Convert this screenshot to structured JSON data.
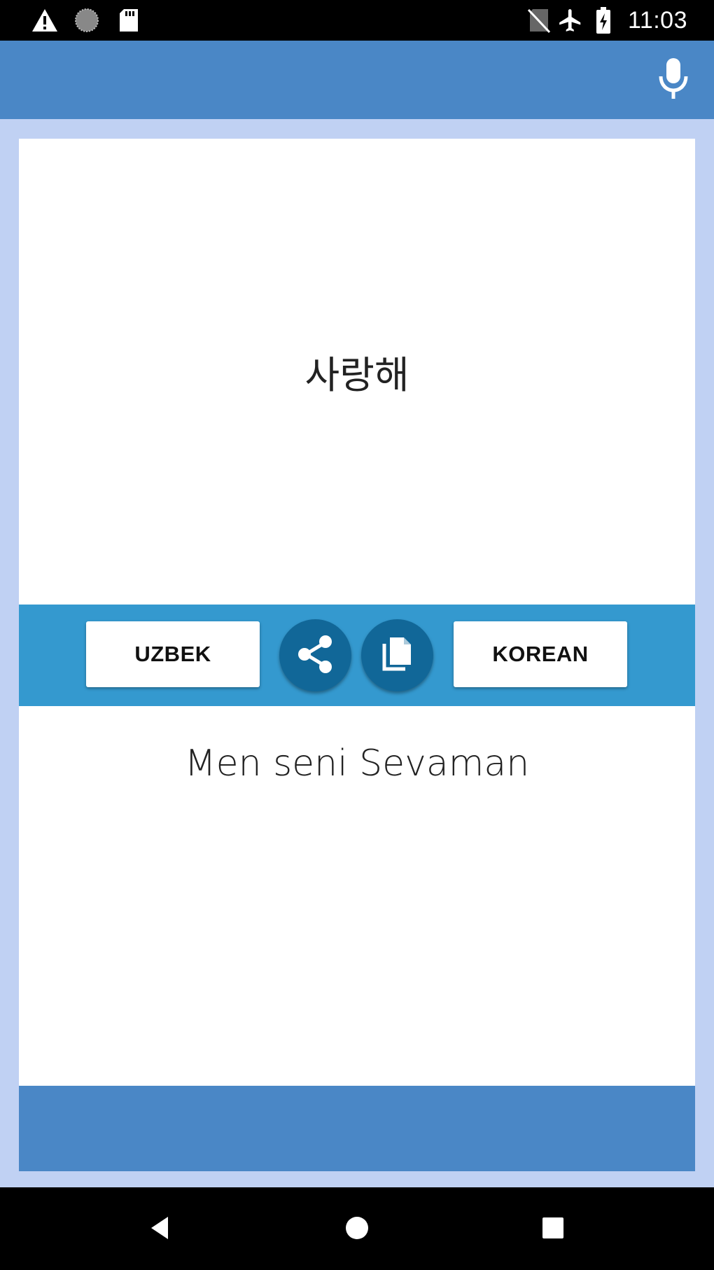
{
  "status_bar": {
    "time": "11:03",
    "icons": [
      "warning-icon",
      "sync-icon",
      "sd-card-icon",
      "no-sim-icon",
      "airplane-icon",
      "battery-charging-icon"
    ]
  },
  "app_bar": {
    "mic_icon": "microphone-icon"
  },
  "translation": {
    "source_text": "사랑해",
    "target_text": "Men seni Sevaman"
  },
  "toolbar": {
    "left_language": "UZBEK",
    "right_language": "KOREAN",
    "share_icon": "share-icon",
    "copy_icon": "copy-icon"
  },
  "colors": {
    "app_bar": "#4a87c6",
    "frame": "#c0d1f3",
    "toolbar": "#3499cf",
    "round_button": "#116798"
  },
  "nav_bar": {
    "icons": [
      "back-icon",
      "home-icon",
      "recents-icon"
    ]
  }
}
